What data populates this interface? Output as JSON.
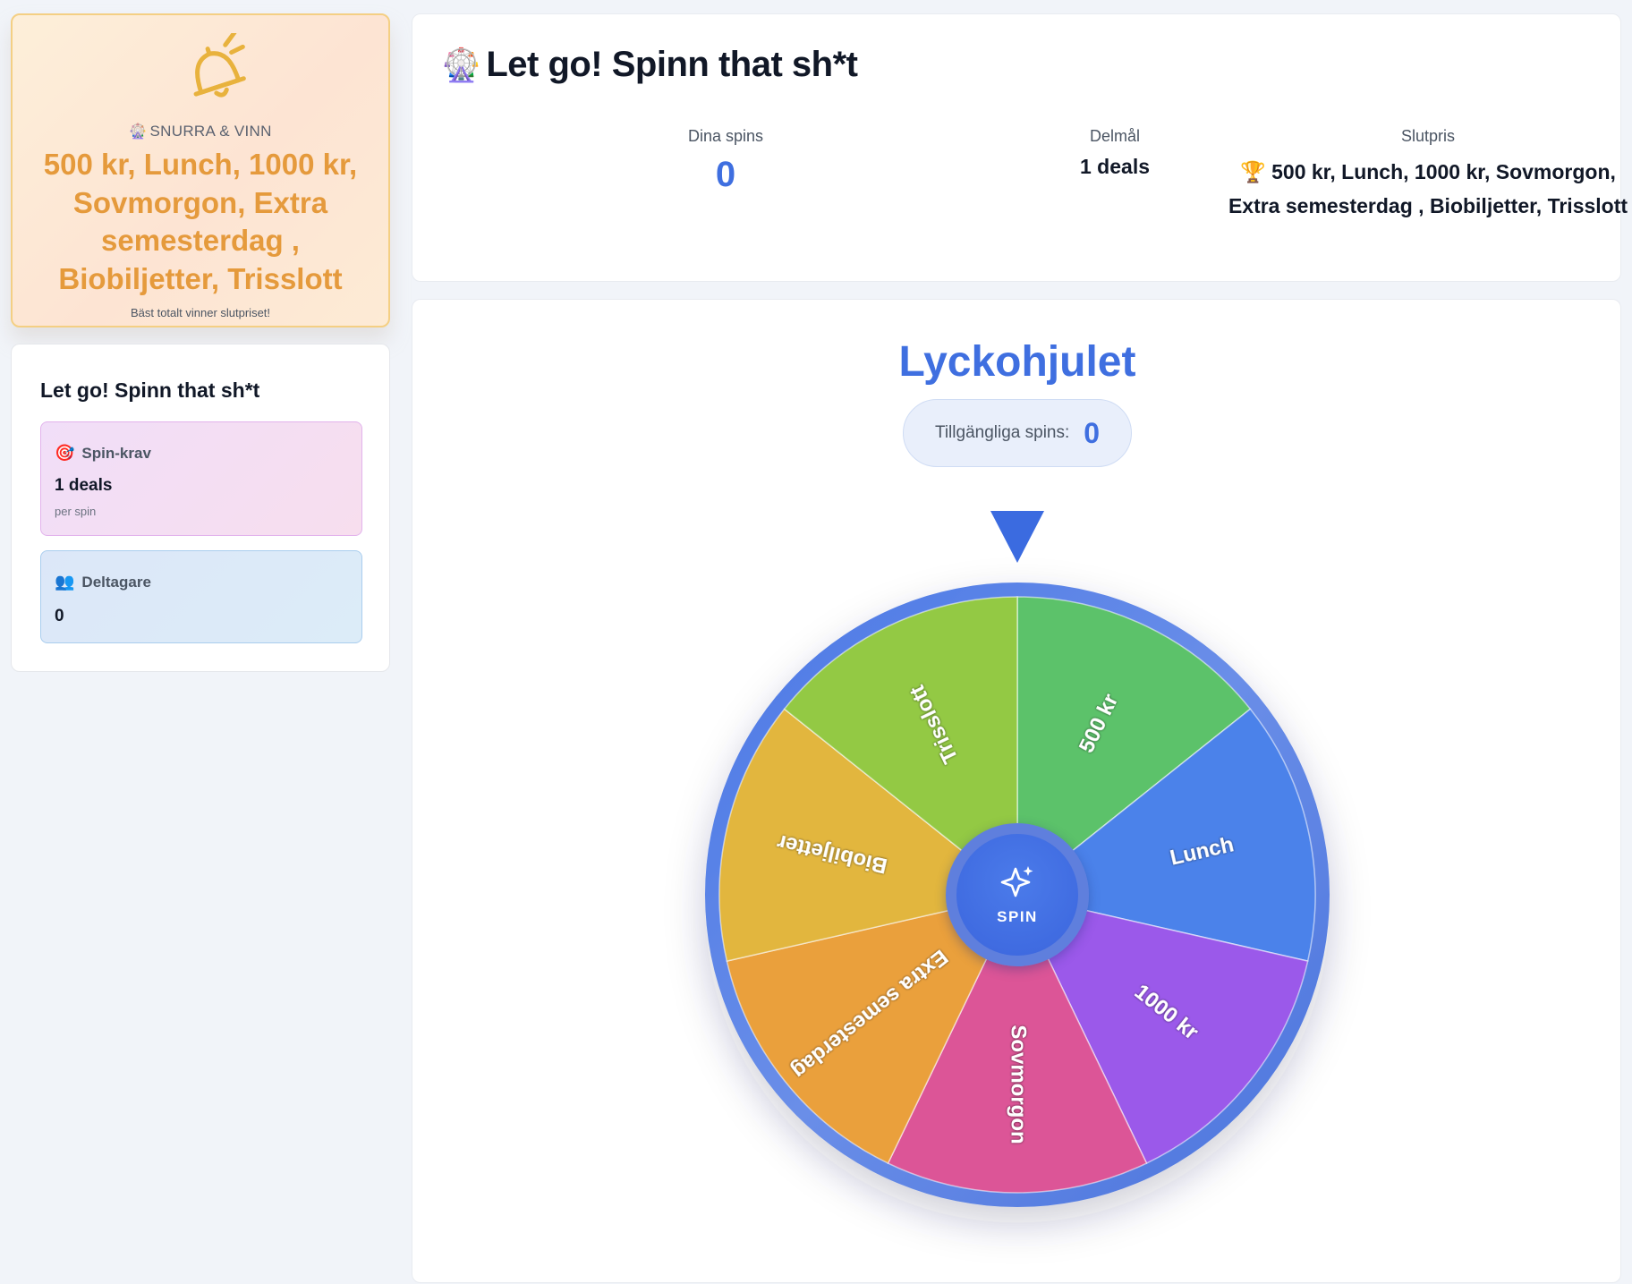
{
  "promo": {
    "icon": "bell-icon",
    "subtitle_icon": "🎡",
    "subtitle": "SNURRA & VINN",
    "prizes": "500 kr, Lunch, 1000 kr, Sovmorgon, Extra semesterdag , Biobiljetter, Trisslott",
    "footer": "Bäst totalt vinner slutpriset!",
    "accent_color": "#e59a3c"
  },
  "sidebar": {
    "title": "Let go! Spinn that sh*t",
    "spin_req": {
      "icon": "🎯",
      "label": "Spin-krav",
      "value": "1 deals",
      "note": "per spin"
    },
    "participants": {
      "icon": "👥",
      "label": "Deltagare",
      "value": "0"
    }
  },
  "header": {
    "icon": "🎡",
    "title": "Let go! Spinn that sh*t",
    "stats": {
      "spins_label": "Dina spins",
      "spins_value": "0",
      "goal_label": "Delmål",
      "goal_value": "1 deals",
      "final_label": "Slutpris",
      "final_icon": "🏆",
      "final_value": "500 kr, Lunch, 1000 kr, Sovmorgon, Extra semesterdag , Biobiljetter, Trisslott"
    }
  },
  "wheel": {
    "title": "Lyckohjulet",
    "available_label": "Tillgängliga spins:",
    "available_value": "0",
    "spin_label": "SPIN",
    "segments": [
      {
        "label": "500 kr",
        "color": "#5cc26a"
      },
      {
        "label": "Lunch",
        "color": "#4b82ea"
      },
      {
        "label": "1000 kr",
        "color": "#9b59ea"
      },
      {
        "label": "Sovmorgon",
        "color": "#dc5597"
      },
      {
        "label": "Extra semesterdag",
        "color": "#eaa03c"
      },
      {
        "label": "Biobiljetter",
        "color": "#e2b63e"
      },
      {
        "label": "Trisslott",
        "color": "#93c944"
      }
    ],
    "rim_color": "#4f79e2",
    "pointer_color": "#3b6be0"
  }
}
